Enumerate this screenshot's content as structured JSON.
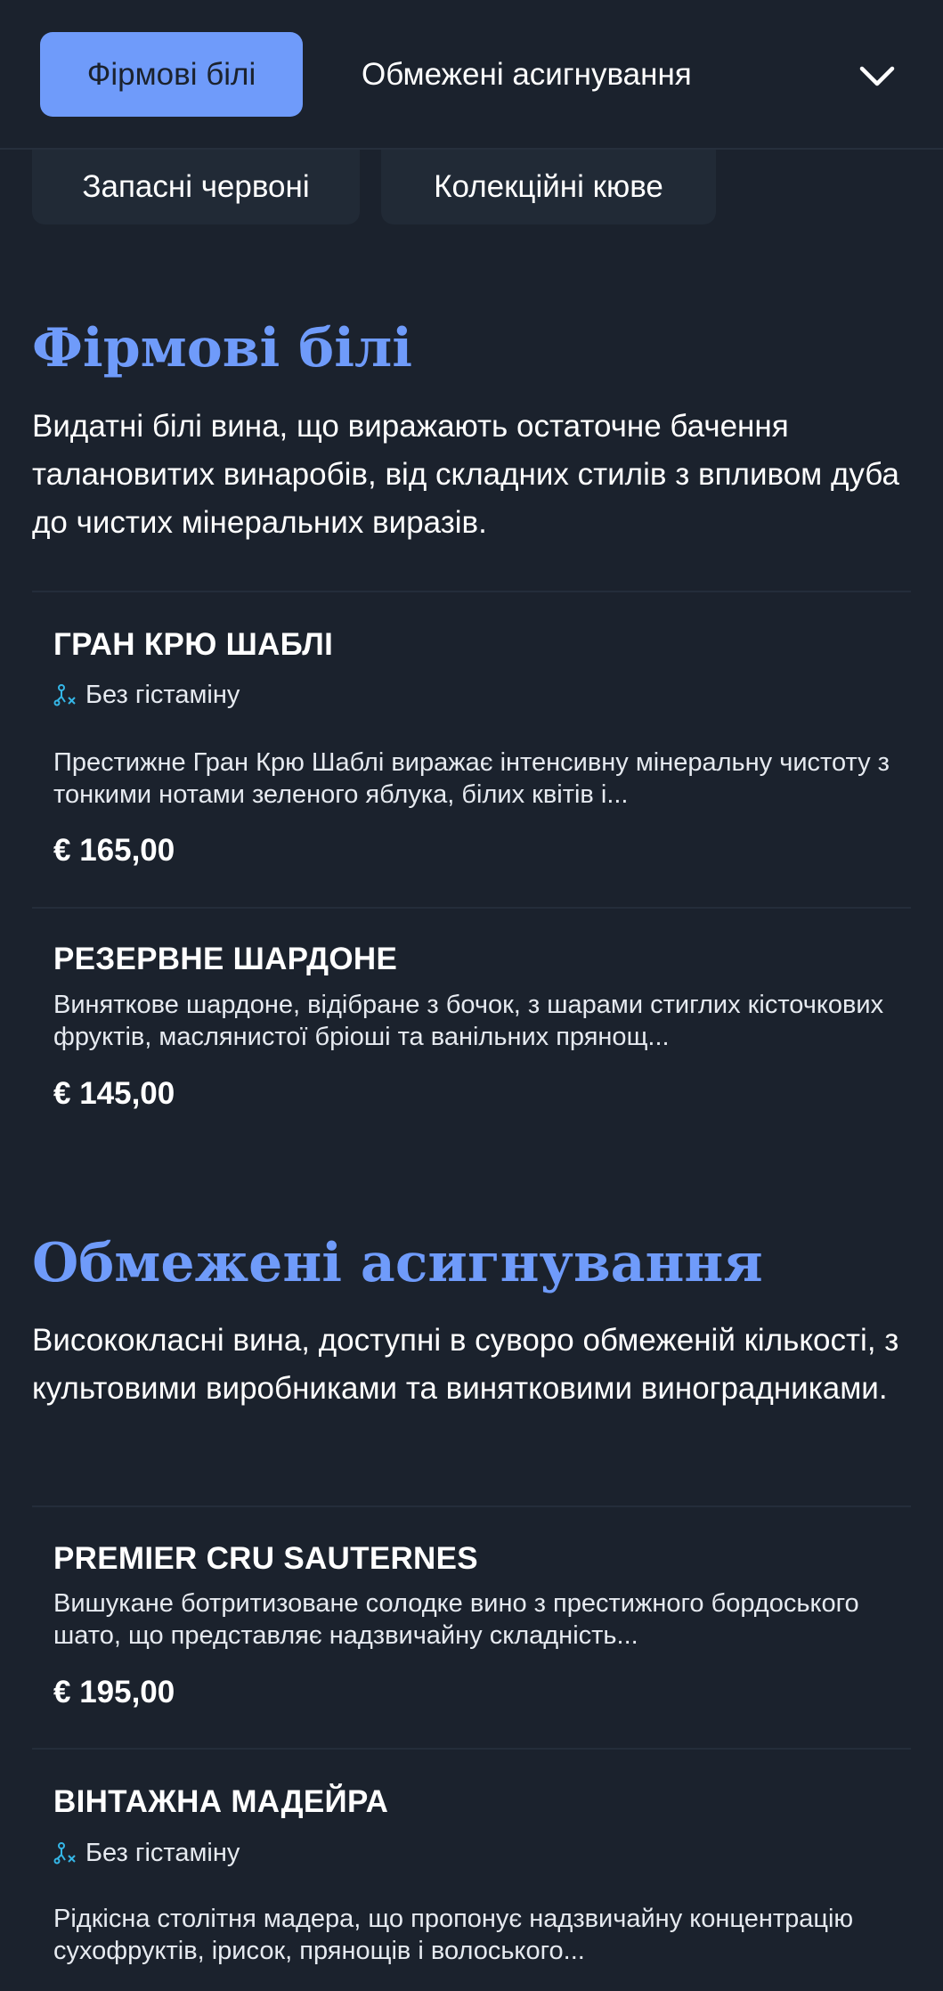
{
  "nav": {
    "tabs": [
      {
        "label": "Фірмові білі",
        "active": true
      },
      {
        "label": "Обмежені асигнування",
        "active": false
      }
    ],
    "chips": [
      "Запасні червоні",
      "Колекційні кюве"
    ],
    "expand_icon": "chevron-down-icon"
  },
  "sections": [
    {
      "title": "Фірмові білі",
      "description": "Видатні білі вина, що виражають остаточне бачення талановитих винаробів, від складних стилів з впливом дуба до чистих мінеральних виразів.",
      "items": [
        {
          "name": "ГРАН КРЮ ШАБЛІ",
          "tag": "Без гістаміну",
          "tag_icon": "histamine-free-icon",
          "description": "Престижне Гран Крю Шаблі виражає інтенсивну мінеральну чистоту з тонкими нотами зеленого яблука, білих квітів і...",
          "price": "€ 165,00"
        },
        {
          "name": "РЕЗЕРВНЕ ШАРДОНЕ",
          "description": "Виняткове шардоне, відібране з бочок, з шарами стиглих кісточкових фруктів, маслянистої бріоші та ванільних прянощ...",
          "price": "€ 145,00"
        }
      ]
    },
    {
      "title": "Обмежені асигнування",
      "description": "Висококласні вина, доступні в суворо обмеженій кількості, з культовими виробниками та винятковими виноградниками.",
      "items": [
        {
          "name": "PREMIER CRU SAUTERNES",
          "description": "Вишукане ботритизоване солодке вино з престижного бордоського шато, що представляє надзвичайну складність...",
          "price": "€ 195,00"
        },
        {
          "name": "ВІНТАЖНА МАДЕЙРА",
          "tag": "Без гістаміну",
          "tag_icon": "histamine-free-icon",
          "description": "Рідкісна столітня мадера, що пропонує надзвичайну концентрацію сухофруктів, ірисок, прянощів і волоського...",
          "price": ""
        }
      ]
    }
  ],
  "colors": {
    "background": "#1b222d",
    "accent": "#6f9bfa",
    "chip": "#212a36",
    "tag_icon": "#35b6e6"
  }
}
